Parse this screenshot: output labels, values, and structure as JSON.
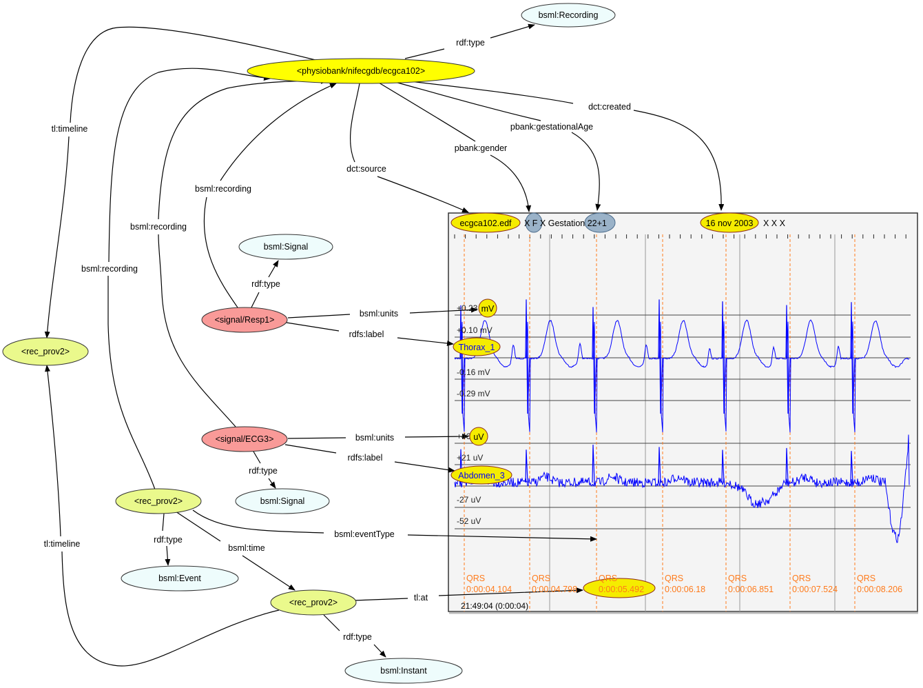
{
  "colors": {
    "class_node": "#eefcfc",
    "resource_node": "#ffff00",
    "instance_node": "#eaf98c",
    "signal_node": "#f99a98",
    "annotation_fill": "#f5ec00",
    "blue_annotation": "#9ab2c8",
    "waveform": "#0000ff",
    "qrs": "#ff7a1a",
    "panel_bg": "#f4f4f4"
  },
  "nodes": [
    {
      "label": "bsml:Recording",
      "kind": "class"
    },
    {
      "label": "<physiobank/nifecgdb/ecgca102>",
      "kind": "resource"
    },
    {
      "label": "<rec_prov2>",
      "kind": "instance"
    },
    {
      "label": "bsml:Signal",
      "kind": "class"
    },
    {
      "label": "<signal/Resp1>",
      "kind": "signal"
    },
    {
      "label": "<signal/ECG3>",
      "kind": "signal"
    },
    {
      "label": "bsml:Signal",
      "kind": "class"
    },
    {
      "label": "<rec_prov2>",
      "kind": "instance"
    },
    {
      "label": "bsml:Event",
      "kind": "class"
    },
    {
      "label": "<rec_prov2>",
      "kind": "instance"
    },
    {
      "label": "bsml:Instant",
      "kind": "class"
    }
  ],
  "edges": [
    "rdf:type",
    "dct:created",
    "pbank:gestationalAge",
    "pbank:gender",
    "dct:source",
    "tl:timeline",
    "bsml:recording",
    "bsml:recording",
    "bsml:recording",
    "rdf:type",
    "bsml:units",
    "rdfs:label",
    "bsml:units",
    "rdfs:label",
    "rdf:type",
    "rdf:type",
    "bsml:time",
    "bsml:eventType",
    "tl:timeline",
    "tl:at",
    "rdf:type"
  ],
  "panel": {
    "file": "ecgca102.edf",
    "header_mid": "X F X Gestation 22+1",
    "date": "16 nov 2003",
    "header_tail": "X X X",
    "signal1": {
      "units": "mV",
      "label": "Thorax_1",
      "scale": [
        "+0.23",
        "+0.10 mV",
        "-0.16 mV",
        "-0.29 mV"
      ]
    },
    "signal2": {
      "units": "uV",
      "label": "Abdomen_3",
      "scale": [
        "+46",
        "+21 uV",
        "-27 uV",
        "-52 uV"
      ]
    },
    "qrs_label": "QRS",
    "qrs_times": [
      "0:00:04.104",
      "0:00:04.798",
      "0:00:05.492",
      "0:00:06.18",
      "0:00:06.851",
      "0:00:07.524",
      "0:00:08.206"
    ],
    "start_time": "21:49:04 (0:00:04)"
  }
}
